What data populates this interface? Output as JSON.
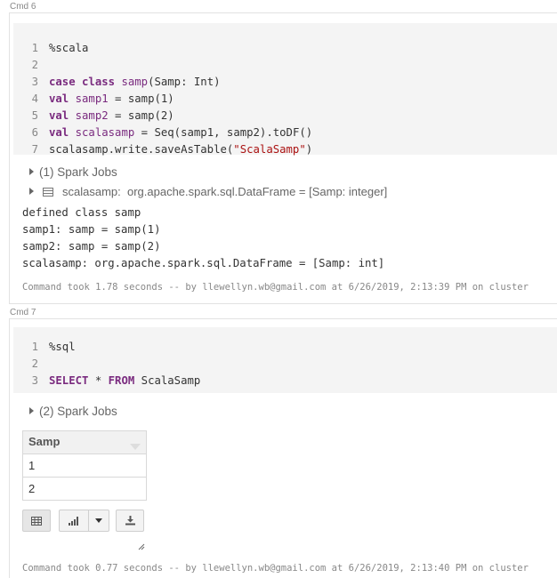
{
  "cells": [
    {
      "label": "Cmd 6",
      "lines": [
        {
          "n": "1",
          "tokens": [
            {
              "t": "%scala",
              "c": "plain"
            }
          ]
        },
        {
          "n": "2",
          "tokens": []
        },
        {
          "n": "3",
          "tokens": [
            {
              "t": "case class ",
              "c": "kw"
            },
            {
              "t": "samp",
              "c": "fn"
            },
            {
              "t": "(Samp: Int)",
              "c": "plain"
            }
          ]
        },
        {
          "n": "4",
          "tokens": [
            {
              "t": "val ",
              "c": "kw"
            },
            {
              "t": "samp1",
              "c": "fn"
            },
            {
              "t": " = samp(1)",
              "c": "plain"
            }
          ]
        },
        {
          "n": "5",
          "tokens": [
            {
              "t": "val ",
              "c": "kw"
            },
            {
              "t": "samp2",
              "c": "fn"
            },
            {
              "t": " = samp(2)",
              "c": "plain"
            }
          ]
        },
        {
          "n": "6",
          "tokens": [
            {
              "t": "val ",
              "c": "kw"
            },
            {
              "t": "scalasamp",
              "c": "fn"
            },
            {
              "t": " = Seq(samp1, samp2).toDF()",
              "c": "plain"
            }
          ]
        },
        {
          "n": "7",
          "tokens": [
            {
              "t": "scalasamp.write.saveAsTable(",
              "c": "plain"
            },
            {
              "t": "\"ScalaSamp\"",
              "c": "str"
            },
            {
              "t": ")",
              "c": "plain"
            }
          ]
        }
      ],
      "spark_jobs": "(1) Spark Jobs",
      "dataframe_name": "scalasamp:",
      "dataframe_type": "org.apache.spark.sql.DataFrame = [Samp: integer]",
      "output": [
        "defined class samp",
        "samp1: samp = samp(1)",
        "samp2: samp = samp(2)",
        "scalasamp: org.apache.spark.sql.DataFrame = [Samp: int]"
      ],
      "took": "Command took 1.78 seconds -- by llewellyn.wb@gmail.com at 6/26/2019, 2:13:39 PM on cluster"
    },
    {
      "label": "Cmd 7",
      "lines": [
        {
          "n": "1",
          "tokens": [
            {
              "t": "%sql",
              "c": "plain"
            }
          ]
        },
        {
          "n": "2",
          "tokens": []
        },
        {
          "n": "3",
          "tokens": [
            {
              "t": "SELECT",
              "c": "kw"
            },
            {
              "t": " * ",
              "c": "plain"
            },
            {
              "t": "FROM",
              "c": "kw"
            },
            {
              "t": " ScalaSamp",
              "c": "plain"
            }
          ]
        }
      ],
      "spark_jobs": "(2) Spark Jobs",
      "table": {
        "header": "Samp",
        "rows": [
          "1",
          "2"
        ]
      },
      "took": "Command took 0.77 seconds -- by llewellyn.wb@gmail.com at 6/26/2019, 2:13:40 PM on cluster"
    }
  ],
  "icons": {
    "table_button": "table-icon",
    "chart_button": "bar-chart-icon",
    "chart_dropdown": "caret-down-icon",
    "download_button": "download-icon",
    "resize": "resize-handle-icon"
  },
  "colors": {
    "keyword": "#7a2b7f",
    "string": "#aa1111",
    "editor_bg": "#f4f4f4"
  }
}
